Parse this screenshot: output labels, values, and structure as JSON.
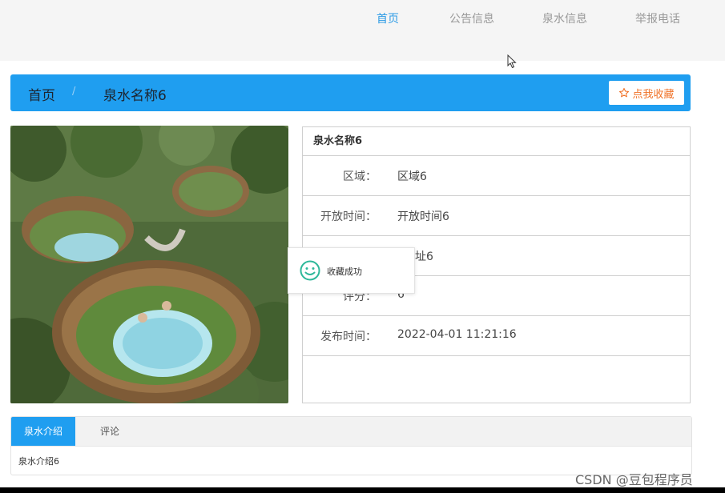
{
  "nav": {
    "items": [
      {
        "label": "首页",
        "active": true
      },
      {
        "label": "公告信息",
        "active": false
      },
      {
        "label": "泉水信息",
        "active": false
      },
      {
        "label": "举报电话",
        "active": false
      }
    ]
  },
  "breadcrumb": {
    "home": "首页",
    "separator": "/",
    "current": "泉水名称6"
  },
  "favorite_button": {
    "label": "点我收藏",
    "icon": "star-outline-icon"
  },
  "detail": {
    "title": "泉水名称6",
    "rows": [
      {
        "label": "区域：",
        "value": "区域6"
      },
      {
        "label": "开放时间：",
        "value": "开放时间6"
      },
      {
        "label": "",
        "value": "地址6"
      },
      {
        "label": "评分：",
        "value": "6"
      },
      {
        "label": "发布时间：",
        "value": "2022-04-01 11:21:16"
      }
    ]
  },
  "toast": {
    "text": "收藏成功",
    "icon": "smile-icon"
  },
  "tabs": {
    "items": [
      {
        "label": "泉水介绍",
        "active": true
      },
      {
        "label": "评论",
        "active": false
      }
    ],
    "content": "泉水介绍6"
  },
  "watermark": "CSDN @豆包程序员",
  "colors": {
    "primary": "#1f9ef0",
    "nav_active": "#2d9be5",
    "favorite_text": "#f07228",
    "toast_icon": "#2fb89a"
  }
}
